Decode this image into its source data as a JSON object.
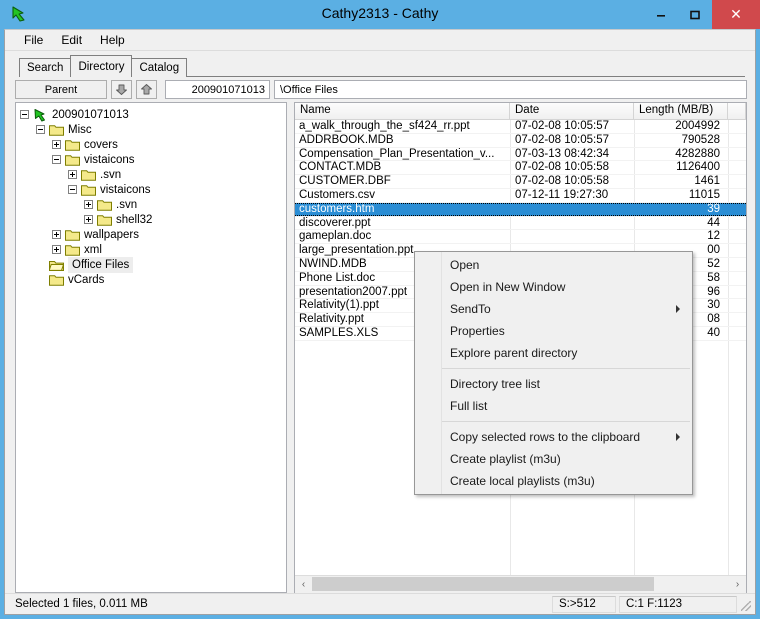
{
  "window": {
    "title": "Cathy2313 - Cathy",
    "icon": "green-arrow-icon",
    "minimize_label": "–",
    "maximize_label": "❑",
    "close_label": "✕",
    "titlebar_color": "#5BAFE3",
    "close_color": "#D0494C"
  },
  "menubar": {
    "items": [
      {
        "label": "File"
      },
      {
        "label": "Edit"
      },
      {
        "label": "Help"
      }
    ]
  },
  "tabs": {
    "items": [
      {
        "label": "Search",
        "active": false
      },
      {
        "label": "Directory",
        "active": true
      },
      {
        "label": "Catalog",
        "active": false
      }
    ]
  },
  "toolbar": {
    "parent_label": "Parent",
    "down_icon": "arrow-down-icon",
    "up_icon": "arrow-up-icon",
    "volume_id": "200901071013",
    "path": "\\Office Files"
  },
  "tree": {
    "nodes": [
      {
        "label": "200901071013",
        "depth": 0,
        "state": "minus",
        "icon": "green-arrow-icon",
        "selected": false
      },
      {
        "label": "Misc",
        "depth": 1,
        "state": "minus",
        "icon": "folder-icon",
        "selected": false
      },
      {
        "label": "covers",
        "depth": 2,
        "state": "plus",
        "icon": "folder-icon",
        "selected": false
      },
      {
        "label": "vistaicons",
        "depth": 2,
        "state": "minus",
        "icon": "folder-icon",
        "selected": false
      },
      {
        "label": ".svn",
        "depth": 3,
        "state": "plus",
        "icon": "folder-icon",
        "selected": false
      },
      {
        "label": "vistaicons",
        "depth": 3,
        "state": "minus",
        "icon": "folder-icon",
        "selected": false
      },
      {
        "label": ".svn",
        "depth": 4,
        "state": "plus",
        "icon": "folder-icon",
        "selected": false
      },
      {
        "label": "shell32",
        "depth": 4,
        "state": "plus",
        "icon": "folder-icon",
        "selected": false
      },
      {
        "label": "wallpapers",
        "depth": 2,
        "state": "plus",
        "icon": "folder-icon",
        "selected": false
      },
      {
        "label": "xml",
        "depth": 2,
        "state": "plus",
        "icon": "folder-icon",
        "selected": false
      },
      {
        "label": "Office Files",
        "depth": 1,
        "state": "none",
        "icon": "folder-open-icon",
        "selected": true
      },
      {
        "label": "vCards",
        "depth": 1,
        "state": "none",
        "icon": "folder-icon",
        "selected": false
      }
    ]
  },
  "filelist": {
    "columns": [
      {
        "key": "name",
        "label": "Name"
      },
      {
        "key": "date",
        "label": "Date"
      },
      {
        "key": "len",
        "label": "Length (MB/B)"
      },
      {
        "key": "rest",
        "label": ""
      }
    ],
    "rows": [
      {
        "name": "a_walk_through_the_sf424_rr.ppt",
        "date": "07-02-08 10:05:57",
        "len": "2004992",
        "selected": false
      },
      {
        "name": "ADDRBOOK.MDB",
        "date": "07-02-08 10:05:57",
        "len": "790528",
        "selected": false
      },
      {
        "name": "Compensation_Plan_Presentation_v...",
        "date": "07-03-13 08:42:34",
        "len": "4282880",
        "selected": false
      },
      {
        "name": "CONTACT.MDB",
        "date": "07-02-08 10:05:58",
        "len": "1126400",
        "selected": false
      },
      {
        "name": "CUSTOMER.DBF",
        "date": "07-02-08 10:05:58",
        "len": "1461",
        "selected": false
      },
      {
        "name": "Customers.csv",
        "date": "07-12-11 19:27:30",
        "len": "11015",
        "selected": false
      },
      {
        "name": "customers.htm",
        "date": "",
        "len": "39",
        "selected": true
      },
      {
        "name": "discoverer.ppt",
        "date": "",
        "len": "44",
        "selected": false
      },
      {
        "name": "gameplan.doc",
        "date": "",
        "len": "12",
        "selected": false
      },
      {
        "name": "large_presentation.ppt",
        "date": "",
        "len": "00",
        "selected": false
      },
      {
        "name": "NWIND.MDB",
        "date": "",
        "len": "52",
        "selected": false
      },
      {
        "name": "Phone List.doc",
        "date": "",
        "len": "58",
        "selected": false
      },
      {
        "name": "presentation2007.ppt",
        "date": "",
        "len": "96",
        "selected": false
      },
      {
        "name": "Relativity(1).ppt",
        "date": "",
        "len": "30",
        "selected": false
      },
      {
        "name": "Relativity.ppt",
        "date": "",
        "len": "08",
        "selected": false
      },
      {
        "name": "SAMPLES.XLS",
        "date": "",
        "len": "40",
        "selected": false
      }
    ]
  },
  "context_menu": {
    "items": [
      {
        "label": "Open",
        "submenu": false,
        "separator_after": false
      },
      {
        "label": "Open in New Window",
        "submenu": false,
        "separator_after": false
      },
      {
        "label": "SendTo",
        "submenu": true,
        "separator_after": false
      },
      {
        "label": "Properties",
        "submenu": false,
        "separator_after": false
      },
      {
        "label": "Explore parent directory",
        "submenu": false,
        "separator_after": true
      },
      {
        "label": "Directory tree list",
        "submenu": false,
        "separator_after": false
      },
      {
        "label": "Full list",
        "submenu": false,
        "separator_after": true
      },
      {
        "label": "Copy selected rows to the clipboard",
        "submenu": true,
        "separator_after": false
      },
      {
        "label": "Create playlist (m3u)",
        "submenu": false,
        "separator_after": false
      },
      {
        "label": "Create local playlists (m3u)",
        "submenu": false,
        "separator_after": false
      }
    ]
  },
  "scrollbar": {
    "left_arrow": "‹",
    "right_arrow": "›"
  },
  "statusbar": {
    "main": "Selected 1 files, 0.011 MB",
    "sector": "S:>512",
    "counts": "C:1 F:1123"
  }
}
